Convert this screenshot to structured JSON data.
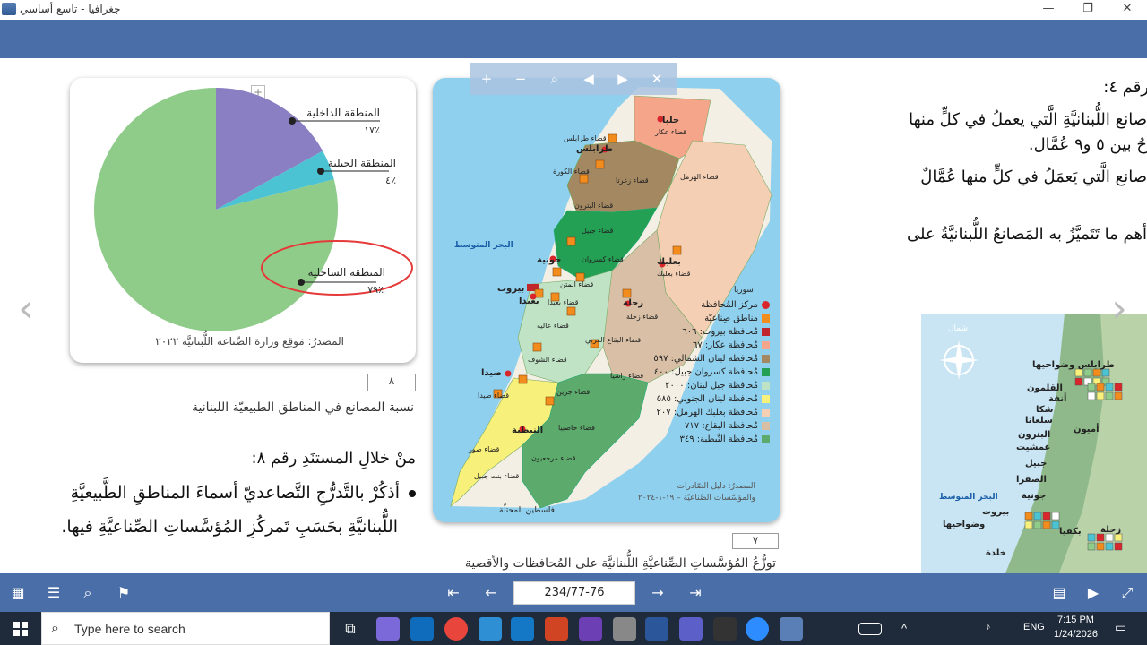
{
  "window": {
    "title": "جغرافيا - تاسع أساسي",
    "minimize_glyph": "—",
    "restore_glyph": "❐",
    "close_glyph": "✕"
  },
  "pie_figure": {
    "plus_glyph": "+",
    "source": "المصدرُ: مَوقِع وزارة الصِّناعة اللُّبنانيَّة ٢٠٢٢",
    "number": "٨",
    "caption": "نسبة المصانع في المناطق الطبيعيّة اللبنانية"
  },
  "chart_data": {
    "type": "pie",
    "categories": [
      "المنطقة الداخلية",
      "المنطقة الجبلية",
      "المنطقة الساحلية"
    ],
    "labels_pct": [
      "٪١٧",
      "٪٤",
      "٪٧٩"
    ],
    "values": [
      17,
      4,
      79
    ],
    "colors": [
      "#8a7fc2",
      "#4cc3d3",
      "#8fcc8a"
    ],
    "highlighted": "المنطقة الساحلية"
  },
  "left_text": {
    "intro": "منْ خلالِ المستنَدِ رقم ٨:",
    "bullet_line1": "أذكُرْ بالتَّدرُّجِ التَّصاعديّ أسماءَ المناطقِ الطَّبيعيَّةِ",
    "bullet_line2": "اللُّبنانيَّةِ بحَسَبِ تَمركُزِ المُؤسَّساتِ الصِّناعيَّةِ فيها."
  },
  "zoom_toolbar": {
    "zoom_in": "+",
    "zoom_out": "−",
    "search": "⌕",
    "prev": "◀",
    "next": "▶",
    "close": "✕"
  },
  "map_figure": {
    "sea_label": "البحر المتوسط",
    "syria_label": "سوريا",
    "palestine_label": "فلسطين المحتلّة",
    "cities": [
      "حلبا",
      "طرابلس",
      "جونية",
      "بيروت",
      "بعبدا",
      "زحلة",
      "بعلبك",
      "صيدا",
      "النبطية"
    ],
    "districts": [
      "قضاء عكار",
      "قضاء طرابلس",
      "قضاء الكورة",
      "قضاء زغرتا",
      "قضاء الهرمل",
      "قضاء البترون",
      "قضاء جبيل",
      "قضاء كسروان",
      "قضاء بعلبك",
      "قضاء المتن",
      "قضاء بعبدا",
      "قضاء عاليه",
      "قضاء الشوف",
      "قضاء زحلة",
      "قضاء البقاع الغربي",
      "قضاء راشيا",
      "قضاء صيدا",
      "قضاء جزين",
      "قضاء صور",
      "قضاء مرجعيون",
      "قضاء بنت جبيل",
      "قضاء حاصبيا"
    ],
    "legend": [
      {
        "label": "مركز المُحافظة",
        "color": "#d9262b"
      },
      {
        "label": "مناطق صِناعيّة",
        "color": "#f28c1c"
      },
      {
        "label": "مُحافظة بيروت: ٦٠٦",
        "color": "#c0262b"
      },
      {
        "label": "مُحافظة عكار: ٦٧",
        "color": "#f4a58a"
      },
      {
        "label": "مُحافظة لبنان الشمالي: ٥٩٧",
        "color": "#a38862"
      },
      {
        "label": "مُحافظة كسروان جبيل: ٤٠٠",
        "color": "#23a053"
      },
      {
        "label": "مُحافظة جبل لبنان: ٢٠٠٠",
        "color": "#bfe3c4"
      },
      {
        "label": "مُحافظة لبنان الجنوبي: ٥٨٥",
        "color": "#f7f07a"
      },
      {
        "label": "مُحافظة بعلبك الهرمل: ٢٠٧",
        "color": "#f5cfb3"
      },
      {
        "label": "مُحافظة البقاع: ٧١٧",
        "color": "#d8bfa5"
      },
      {
        "label": "مُحافظة النَّبطية: ٣٤٩",
        "color": "#5caa6c"
      }
    ],
    "source_line1": "المصدرُ: دليل الصّادرات",
    "source_line2": "والمؤسّسات الصِّناعيّة – ١٩-١-٢٠٢٤",
    "number": "٧",
    "caption": "توزُّعُ المُؤسَّساتِ الصِّناعيَّةِ اللُّبنانيَّة على المُحافظات والأقضية"
  },
  "right_text": {
    "heading": "رقم ٤:",
    "line1": "صانع اللُّبنانيَّةِ الَّتي يعملُ في كلٍّ منها",
    "line2": "حُ بين ٥ و٩ عُمَّال.",
    "line3": "صانع الَّتي يَعمَلُ في كلٍّ منها عُمَّالٌ",
    "line4": "أهم ما تَتَميَّزُ به المَصانعُ اللُّبنانيَّةُ على"
  },
  "right_map": {
    "north": "شمال",
    "sea": "البحر المتوسط",
    "places": [
      "طرابلس وضواحيها",
      "القلمون",
      "أنفة",
      "شكا",
      "سلعاتا",
      "البترون",
      "عمشيت",
      "جبيل",
      "الصفرا",
      "جونية",
      "بيروت",
      "وضواحيها",
      "خلدة",
      "زحلة",
      "بكفيا",
      "أميون"
    ]
  },
  "viewer_toolbar": {
    "page_value": "234/77-76"
  },
  "taskbar": {
    "search_placeholder": "Type here to search",
    "language": "ENG",
    "time": "7:15 PM",
    "date": "1/24/2026"
  }
}
